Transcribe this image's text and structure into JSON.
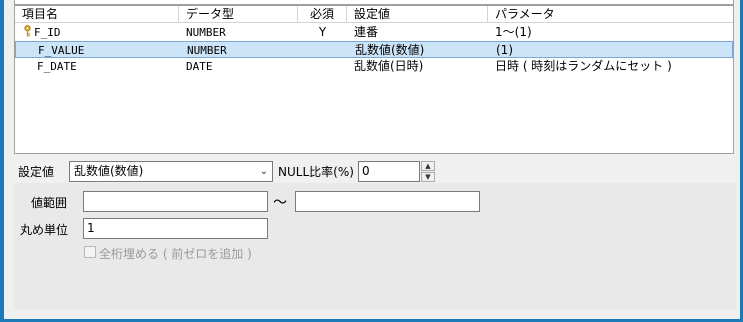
{
  "grid": {
    "headers": [
      "項目名",
      "データ型",
      "必須",
      "設定値",
      "パラメータ"
    ],
    "rows": [
      {
        "key_icon": "key-icon",
        "name": "F_ID",
        "type": "NUMBER",
        "required": "Y",
        "setting": "連番",
        "param": "1〜(1)"
      },
      {
        "name": "F_VALUE",
        "type": "NUMBER",
        "required": "",
        "setting": "乱数値(数値)",
        "param": "(1)"
      },
      {
        "name": "F_DATE",
        "type": "DATE",
        "required": "",
        "setting": "乱数値(日時)",
        "param": "日時 ( 時刻はランダムにセット )"
      }
    ]
  },
  "settings": {
    "label": "設定値",
    "selected": "乱数値(数値)",
    "null_ratio_label": "NULL比率(%)",
    "null_ratio_value": "0"
  },
  "detail": {
    "range_label": "値範囲",
    "range_sep": "〜",
    "range_min": "",
    "range_max": "",
    "round_label": "丸め単位",
    "round_value": "1",
    "zero_fill_label": "全桁埋める ( 前ゼロを追加 )"
  },
  "colors": {
    "selection": "#cce4f7",
    "frame": "#1c7ab8"
  }
}
